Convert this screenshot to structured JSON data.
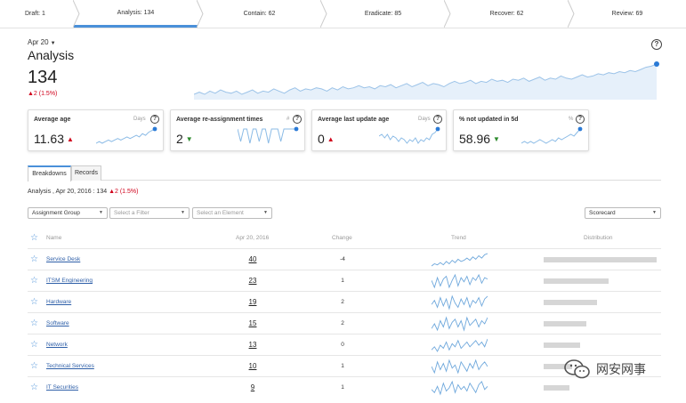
{
  "stages": [
    {
      "label": "Draft: 1",
      "active": false
    },
    {
      "label": "Analysis: 134",
      "active": true
    },
    {
      "label": "Contain: 62",
      "active": false
    },
    {
      "label": "Eradicate: 85",
      "active": false
    },
    {
      "label": "Recover: 62",
      "active": false
    },
    {
      "label": "Review: 69",
      "active": false
    }
  ],
  "header": {
    "date": "Apr 20",
    "title": "Analysis",
    "value": "134",
    "change": "▲2 (1.5%)"
  },
  "main_trend": [
    30,
    32,
    30,
    33,
    31,
    34,
    32,
    31,
    33,
    30,
    32,
    34,
    31,
    33,
    32,
    35,
    33,
    31,
    34,
    36,
    33,
    35,
    34,
    36,
    35,
    33,
    36,
    34,
    37,
    35,
    36,
    38,
    36,
    37,
    35,
    38,
    37,
    39,
    36,
    38,
    40,
    37,
    39,
    41,
    38,
    40,
    39,
    37,
    40,
    42,
    40,
    41,
    43,
    40,
    42,
    41,
    44,
    42,
    43,
    41,
    44,
    43,
    45,
    42,
    44,
    46,
    43,
    45,
    44,
    47,
    45,
    44,
    46,
    48,
    46,
    47,
    49,
    48,
    50,
    49,
    51,
    50,
    52,
    51,
    53,
    55,
    56,
    58
  ],
  "cards": [
    {
      "title": "Average age",
      "unit": "Days",
      "value": "11.63",
      "trend_dir": "up",
      "arrow": "▲",
      "spark": [
        4,
        5,
        4,
        5,
        6,
        5,
        6,
        7,
        6,
        7,
        8,
        7,
        8,
        9,
        8,
        10,
        9,
        11,
        12,
        13
      ]
    },
    {
      "title": "Average re-assignment times",
      "unit": "#",
      "value": "2",
      "trend_dir": "down",
      "arrow": "▼",
      "spark": [
        9,
        2,
        9,
        9,
        1,
        9,
        9,
        2,
        9,
        9,
        1,
        9,
        9,
        9,
        2,
        9,
        9,
        9,
        9,
        9
      ]
    },
    {
      "title": "Average last update age",
      "unit": "Days",
      "value": "0",
      "trend_dir": "up",
      "arrow": "▲",
      "spark": [
        8,
        9,
        7,
        9,
        6,
        8,
        7,
        5,
        7,
        6,
        4,
        6,
        5,
        7,
        4,
        6,
        5,
        7,
        6,
        9,
        10,
        12
      ]
    },
    {
      "title": "% not updated in 5d",
      "unit": "%",
      "value": "58.96",
      "trend_dir": "down",
      "arrow": "▼",
      "spark": [
        5,
        6,
        5,
        6,
        5,
        6,
        7,
        6,
        5,
        6,
        7,
        6,
        8,
        7,
        8,
        9,
        10,
        9,
        11,
        13
      ]
    }
  ],
  "tabs": [
    {
      "label": "Breakdowns",
      "active": true
    },
    {
      "label": "Records",
      "active": false
    }
  ],
  "breadcrumb": {
    "text": "Analysis , Apr 20, 2016 : 134",
    "change": "▲2 (1.5%)"
  },
  "filters": {
    "group": "Assignment Group",
    "filter_placeholder": "Select a Filter",
    "element_placeholder": "Select an Element",
    "view": "Scorecard"
  },
  "table": {
    "headers": {
      "name": "Name",
      "date": "Apr 20, 2016",
      "change": "Change",
      "trend": "Trend",
      "distribution": "Distribution"
    },
    "rows": [
      {
        "name": "Service Desk",
        "value": 40,
        "change": "-4",
        "spark": [
          5,
          7,
          6,
          8,
          6,
          9,
          7,
          10,
          8,
          11,
          9,
          10,
          12,
          10,
          13,
          11,
          14,
          12,
          15,
          16
        ]
      },
      {
        "name": "ITSM Engineering",
        "value": 23,
        "change": "1",
        "spark": [
          10,
          5,
          12,
          6,
          11,
          13,
          5,
          10,
          14,
          6,
          12,
          9,
          13,
          7,
          12,
          10,
          14,
          8,
          12,
          11
        ]
      },
      {
        "name": "Hardware",
        "value": 19,
        "change": "2",
        "spark": [
          8,
          11,
          6,
          13,
          7,
          12,
          5,
          14,
          9,
          6,
          12,
          8,
          13,
          6,
          11,
          9,
          13,
          7,
          12,
          14
        ]
      },
      {
        "name": "Software",
        "value": 15,
        "change": "2",
        "spark": [
          6,
          9,
          5,
          11,
          7,
          13,
          6,
          10,
          12,
          7,
          11,
          5,
          13,
          8,
          10,
          12,
          7,
          11,
          9,
          13
        ]
      },
      {
        "name": "Network",
        "value": 13,
        "change": "0",
        "spark": [
          7,
          9,
          6,
          10,
          8,
          12,
          7,
          11,
          9,
          13,
          8,
          10,
          12,
          9,
          11,
          13,
          10,
          12,
          9,
          14
        ]
      },
      {
        "name": "Technical Services",
        "value": 10,
        "change": "1",
        "spark": [
          9,
          5,
          12,
          7,
          11,
          6,
          13,
          8,
          10,
          5,
          12,
          9,
          6,
          11,
          8,
          13,
          7,
          10,
          12,
          9
        ]
      },
      {
        "name": "IT Securities",
        "value": 9,
        "change": "1",
        "spark": [
          8,
          6,
          10,
          5,
          12,
          7,
          9,
          13,
          6,
          11,
          8,
          10,
          7,
          12,
          9,
          6,
          11,
          13,
          8,
          10
        ]
      }
    ]
  },
  "watermark": "网安网事"
}
